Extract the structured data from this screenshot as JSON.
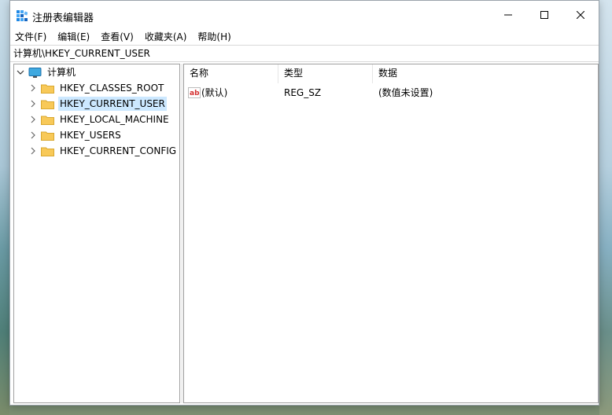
{
  "window": {
    "title": "注册表编辑器",
    "minimize_icon": "minimize-icon",
    "maximize_icon": "maximize-icon",
    "close_icon": "close-icon"
  },
  "menu": {
    "items": [
      {
        "label": "文件(F)"
      },
      {
        "label": "编辑(E)"
      },
      {
        "label": "查看(V)"
      },
      {
        "label": "收藏夹(A)"
      },
      {
        "label": "帮助(H)"
      }
    ]
  },
  "address": {
    "path": "计算机\\HKEY_CURRENT_USER"
  },
  "tree": {
    "root": {
      "label": "计算机",
      "expanded": true,
      "icon": "computer-icon"
    },
    "children": [
      {
        "label": "HKEY_CLASSES_ROOT",
        "selected": false
      },
      {
        "label": "HKEY_CURRENT_USER",
        "selected": true
      },
      {
        "label": "HKEY_LOCAL_MACHINE",
        "selected": false
      },
      {
        "label": "HKEY_USERS",
        "selected": false
      },
      {
        "label": "HKEY_CURRENT_CONFIG",
        "selected": false
      }
    ]
  },
  "list": {
    "columns": [
      {
        "label": "名称"
      },
      {
        "label": "类型"
      },
      {
        "label": "数据"
      }
    ],
    "rows": [
      {
        "name": "(默认)",
        "type": "REG_SZ",
        "data": "(数值未设置)",
        "icon": "string-value-icon"
      }
    ]
  },
  "colors": {
    "selection": "#cce8ff",
    "folder": "#f8c958",
    "border": "#a0a0a0"
  }
}
